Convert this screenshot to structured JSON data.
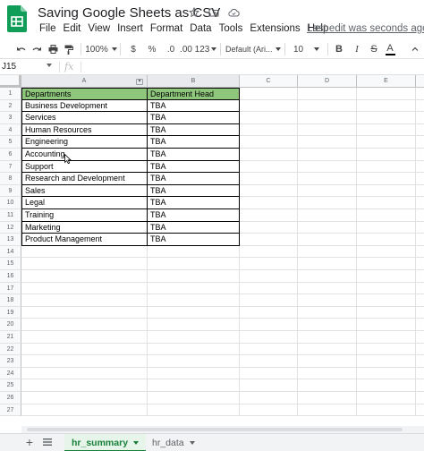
{
  "title": "Saving Google Sheets as CSV",
  "menu": [
    "File",
    "Edit",
    "View",
    "Insert",
    "Format",
    "Data",
    "Tools",
    "Extensions",
    "Help"
  ],
  "last_edit": "Last edit was seconds ago",
  "toolbar": {
    "zoom": "100%",
    "currency": "$",
    "percent": "%",
    "decrease_decimal": ".0",
    "increase_decimal": ".00",
    "more_formats": "123",
    "font": "Default (Ari...",
    "font_size": "10",
    "bold": "B",
    "italic": "I",
    "strikethrough": "S",
    "text_color": "A"
  },
  "formula_bar": {
    "name_box": "J15",
    "fx": "fx",
    "value": ""
  },
  "columns": [
    "A",
    "B",
    "C",
    "D",
    "E"
  ],
  "rows": [
    "1",
    "2",
    "3",
    "4",
    "5",
    "6",
    "7",
    "8",
    "9",
    "10",
    "11",
    "12",
    "13",
    "14",
    "15",
    "16",
    "17",
    "18",
    "19",
    "20",
    "21",
    "22",
    "23",
    "24",
    "25",
    "26",
    "27"
  ],
  "table": {
    "headers": [
      "Departments",
      "Department Head"
    ],
    "rows": [
      [
        "Business Development",
        "TBA"
      ],
      [
        "Services",
        "TBA"
      ],
      [
        "Human Resources",
        "TBA"
      ],
      [
        "Engineering",
        "TBA"
      ],
      [
        "Accounting",
        "TBA"
      ],
      [
        "Support",
        "TBA"
      ],
      [
        "Research and Development",
        "TBA"
      ],
      [
        "Sales",
        "TBA"
      ],
      [
        "Legal",
        "TBA"
      ],
      [
        "Training",
        "TBA"
      ],
      [
        "Marketing",
        "TBA"
      ],
      [
        "Product Management",
        "TBA"
      ]
    ]
  },
  "sheets": {
    "add": "+",
    "tabs": [
      "hr_summary",
      "hr_data"
    ]
  },
  "colors": {
    "header_fill": "#8ec77c",
    "logo_green": "#0f9d58",
    "active_tab": "#188038"
  }
}
